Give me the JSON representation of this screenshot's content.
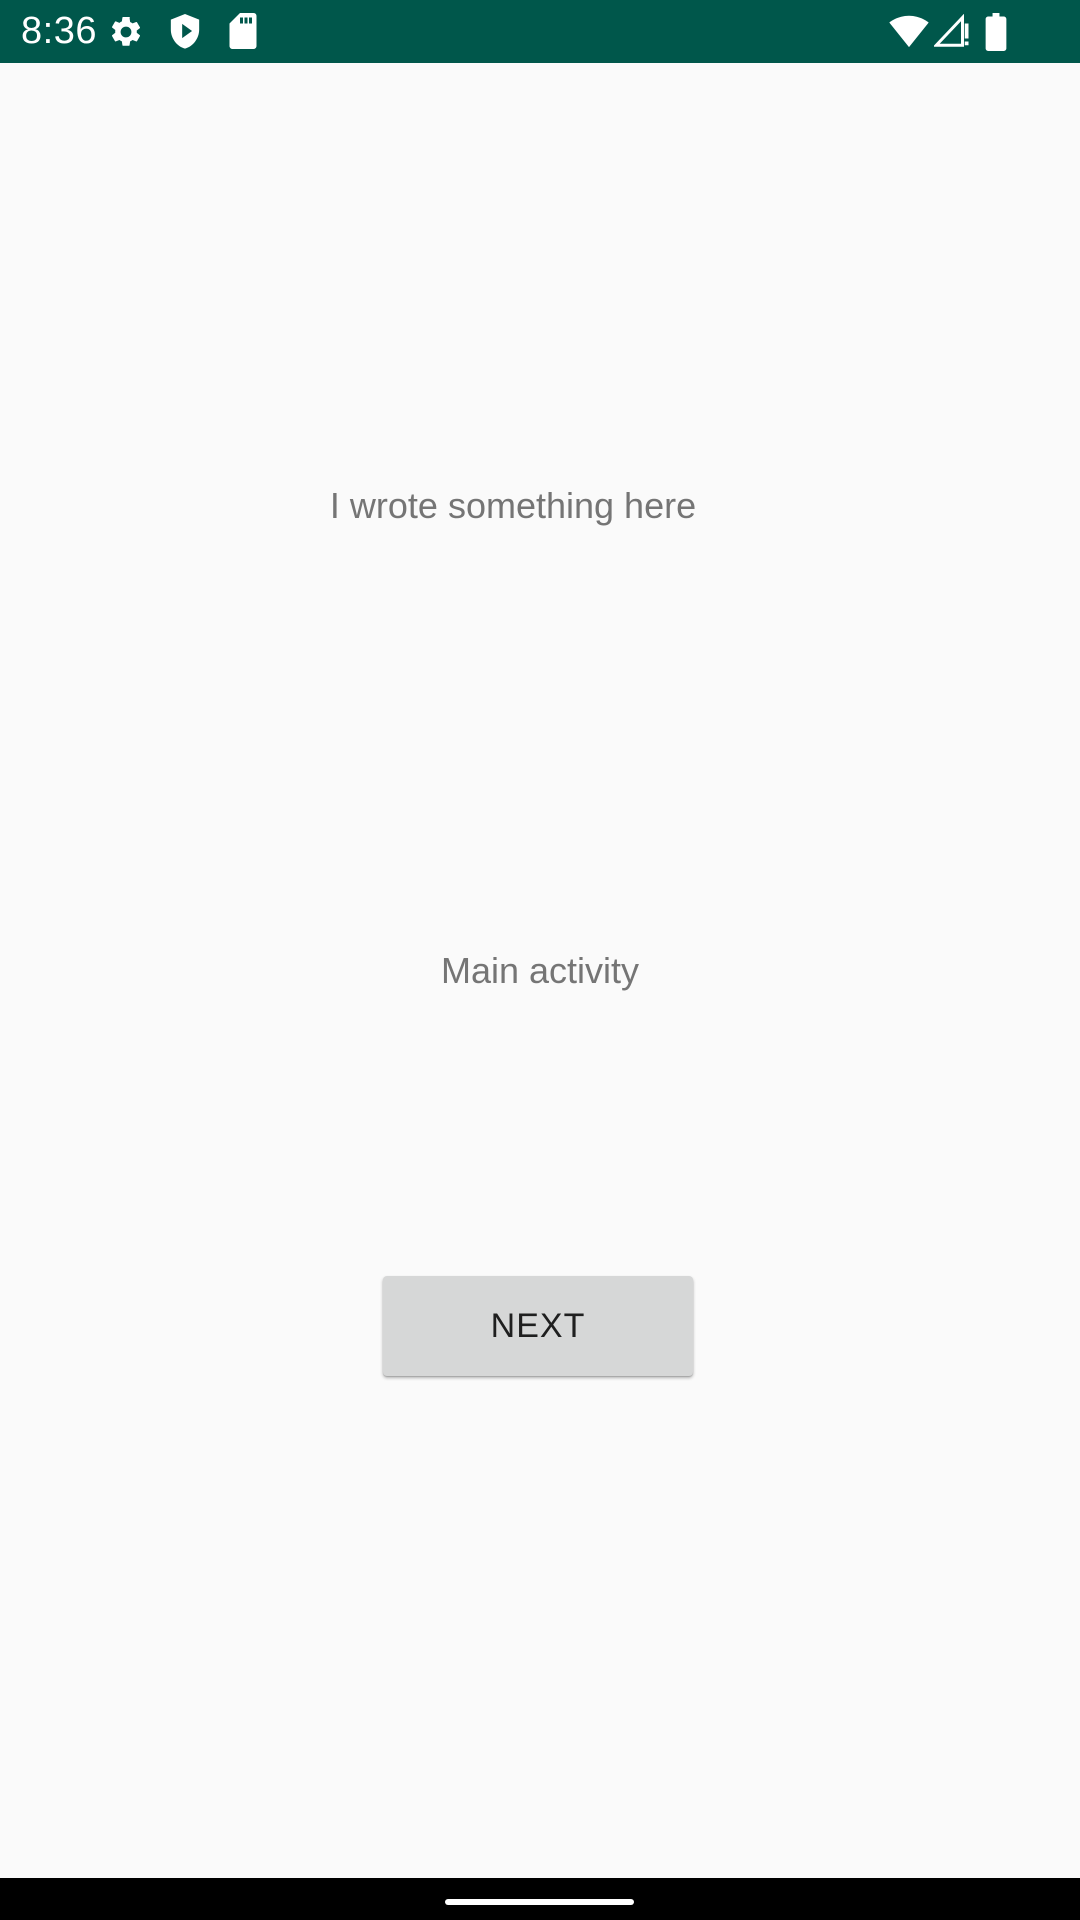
{
  "status_bar": {
    "time": "8:36",
    "background_color": "#00574b",
    "icons": [
      "gear-icon",
      "shield-icon",
      "sd-card-icon",
      "wifi-icon",
      "signal-icon",
      "battery-icon"
    ]
  },
  "main": {
    "text_top": "I wrote something here",
    "text_middle": "Main activity",
    "next_button_label": "NEXT"
  },
  "colors": {
    "background": "#fafafa",
    "text": "#757575",
    "button_background": "#d6d7d7",
    "button_text": "#1f1f1f"
  },
  "nav_bar": {
    "background_color": "#000000",
    "icons": [
      "home-handle"
    ]
  }
}
